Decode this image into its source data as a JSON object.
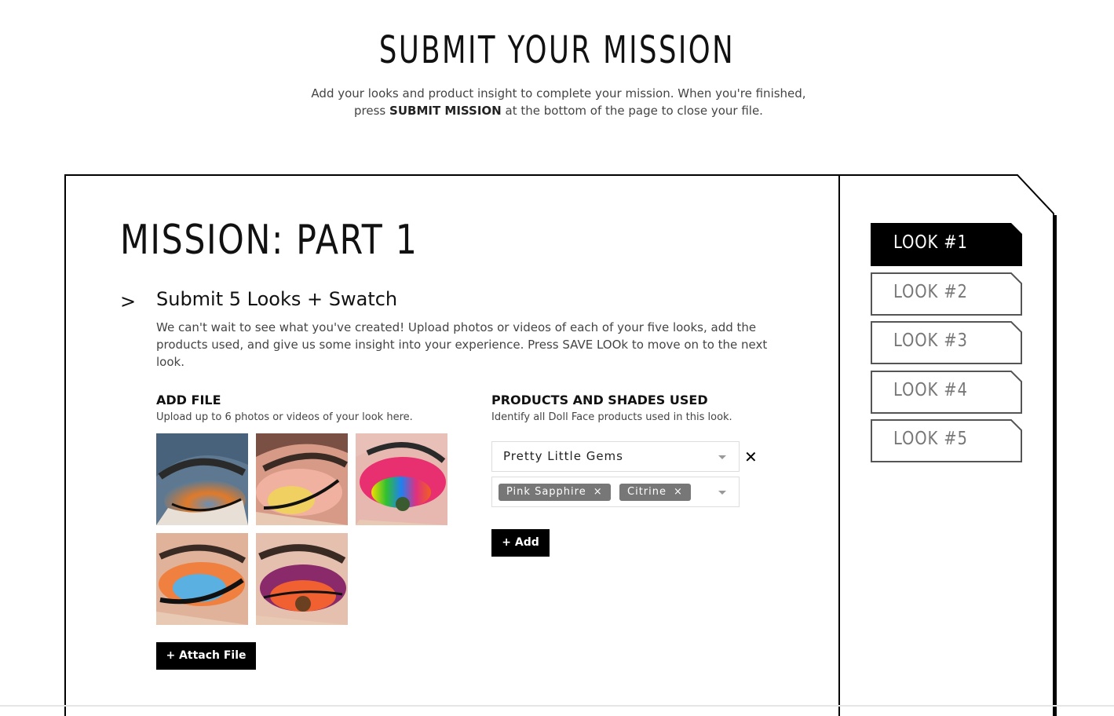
{
  "header": {
    "title": "SUBMIT YOUR MISSION",
    "intro_before": "Add your looks and product insight to complete your mission. When you're finished, press ",
    "intro_bold": "SUBMIT MISSION",
    "intro_after": " at the bottom of the page to close your file."
  },
  "mission": {
    "title": "MISSION: PART 1",
    "task_chevron": ">",
    "task_title": "Submit 5 Looks + Swatch",
    "task_description": "We can't wait to see what you've created! Upload photos or videos of each of your five looks, add the products used, and give us some insight into your experience. Press SAVE LOOk to move on to the next look."
  },
  "add_file": {
    "heading": "ADD FILE",
    "subtext": "Upload up to 6 photos or videos of your look here.",
    "attach_label": "+ Attach File",
    "thumbnails": [
      {
        "icon": "eye-photo-orange"
      },
      {
        "icon": "eye-photo-peach"
      },
      {
        "icon": "eye-photo-rainbow"
      },
      {
        "icon": "eye-photo-blue-orange"
      },
      {
        "icon": "eye-photo-purple"
      }
    ]
  },
  "products": {
    "heading": "PRODUCTS AND SHADES USED",
    "subtext": "Identify all Doll Face products used in this look.",
    "product_select": "Pretty Little Gems",
    "shades": [
      "Pink Sapphire",
      "Citrine"
    ],
    "tag_remove_glyph": "×",
    "remove_glyph": "✕",
    "add_label": "+ Add"
  },
  "looks": {
    "items": [
      {
        "label": "LOOK #1",
        "active": true
      },
      {
        "label": "LOOK #2",
        "active": false
      },
      {
        "label": "LOOK #3",
        "active": false
      },
      {
        "label": "LOOK #4",
        "active": false
      },
      {
        "label": "LOOK #5",
        "active": false
      }
    ]
  },
  "colors": {
    "accent": "#000000",
    "tag_bg": "#777777",
    "inactive_tab_text": "#777777"
  }
}
